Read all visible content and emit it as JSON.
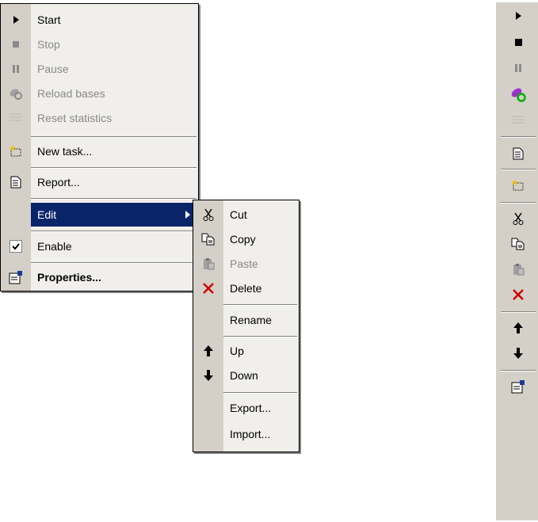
{
  "main_menu": {
    "items": [
      {
        "label": "Start",
        "icon": "play-icon"
      },
      {
        "label": "Stop",
        "icon": "stop-icon",
        "disabled": true
      },
      {
        "label": "Pause",
        "icon": "pause-icon",
        "disabled": true
      },
      {
        "label": "Reload bases",
        "icon": "reload-bases-icon",
        "disabled": true
      },
      {
        "label": "Reset statistics",
        "icon": "reset-statistics-icon",
        "disabled": true
      },
      {
        "label": "New task...",
        "icon": "new-task-icon"
      },
      {
        "label": "Report...",
        "icon": "report-icon"
      },
      {
        "label": "Edit",
        "highlighted": true,
        "has_submenu": true
      },
      {
        "label": "Enable",
        "checked": true
      },
      {
        "label": "Properties...",
        "icon": "properties-icon",
        "bold": true
      }
    ]
  },
  "edit_submenu": {
    "items": [
      {
        "label": "Cut",
        "icon": "cut-icon"
      },
      {
        "label": "Copy",
        "icon": "copy-icon"
      },
      {
        "label": "Paste",
        "icon": "paste-icon",
        "disabled": true
      },
      {
        "label": "Delete",
        "icon": "delete-icon"
      },
      {
        "label": "Rename"
      },
      {
        "label": "Up",
        "icon": "arrow-up-icon"
      },
      {
        "label": "Down",
        "icon": "arrow-down-icon"
      },
      {
        "label": "Export..."
      },
      {
        "label": "Import..."
      }
    ]
  },
  "toolbar": {
    "buttons": [
      "play-icon",
      "stop-icon",
      "pause-icon",
      "reload-bases-icon",
      "reset-statistics-icon",
      "report-icon",
      "new-task-icon",
      "cut-icon",
      "copy-icon",
      "paste-icon",
      "delete-icon",
      "arrow-up-icon",
      "arrow-down-icon",
      "properties-icon"
    ]
  },
  "colors": {
    "menu_bg": "#d4d0c8",
    "highlight": "#0a246a",
    "delete_red": "#cc0000",
    "reload_green": "#00b000",
    "reload_purple": "#9933cc"
  }
}
